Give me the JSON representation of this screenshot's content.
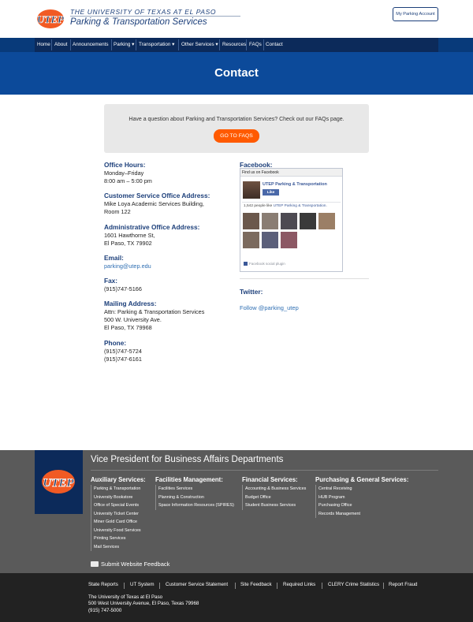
{
  "header": {
    "university": "THE UNIVERSITY OF TEXAS AT EL PASO",
    "department": "Parking & Transportation Services",
    "account_button": "My Parking Account",
    "logo_icon": "utep-logo-icon"
  },
  "nav": {
    "items": [
      "Home",
      "About",
      "Announcements",
      "Parking ▾",
      "Transportation ▾",
      "Other Services ▾",
      "Resources",
      "FAQs",
      "Contact"
    ]
  },
  "hero": {
    "title": "Contact"
  },
  "callout": {
    "text": "Have a question about Parking and Transportation Services? Check out our FAQs page.",
    "button": "GO TO FAQS"
  },
  "contact": {
    "hours_label": "Office Hours:",
    "hours_days": "Monday–Friday",
    "hours_time": "8:00 am – 5:00 pm",
    "customer_label": "Customer Service Office Address:",
    "customer_line1": "Mike Loya Academic Services Building,",
    "customer_line2": "Room 122",
    "admin_label": "Administrative Office Address:",
    "admin_line1": "1601 Hawthorne St,",
    "admin_line2": "El Paso, TX 79902",
    "email_label": "Email:",
    "email": "parking@utep.edu",
    "fax_label": "Fax:",
    "fax": "(915)747-5166",
    "mailing_label": "Mailing Address:",
    "mailing_line1": "Attn: Parking & Transportation Services",
    "mailing_line2": "500 W. University Ave.",
    "mailing_line3": "El Paso, TX 79968",
    "phone_label": "Phone:",
    "phone1": "(915)747-5724",
    "phone2": "(915)747-6161"
  },
  "facebook": {
    "title": "Facebook:",
    "header": "Find us on Facebook",
    "page_name": "UTEP Parking & Transportation",
    "like": "Like",
    "count_prefix": "1,542 people like",
    "count_link": "UTEP Parking & Transportation.",
    "plugin": "Facebook social plugin"
  },
  "twitter": {
    "title": "Twitter:",
    "link": "Follow @parking_utep"
  },
  "footer": {
    "title": "Vice President for Business Affairs Departments",
    "columns": [
      {
        "heading": "Auxiliary Services:",
        "items": [
          "Parking & Transportation",
          "University Bookstore",
          "Office of Special Events",
          "University Ticket Center",
          "Miner Gold Card Office",
          "University Food Services",
          "Printing Services",
          "Mail Services"
        ]
      },
      {
        "heading": "Facilities Management:",
        "items": [
          "Facilities Services",
          "Planning & Construction",
          "Space Information Resources (SPIRES)"
        ]
      },
      {
        "heading": "Financial Services:",
        "items": [
          "Accounting & Business Services",
          "Budget Office",
          "Student Business Services"
        ]
      },
      {
        "heading": "Purchasing & General Services:",
        "items": [
          "Central Receiving",
          "HUB Program",
          "Purchasing Office",
          "Records Management"
        ]
      }
    ],
    "feedback": "Submit Website Feedback",
    "links": [
      "State Reports",
      "UT System",
      "Customer Service Statement",
      "Site Feedback",
      "Required Links",
      "CLERY Crime Statistics",
      "Report Fraud"
    ],
    "address_line1": "The University of Texas at El Paso",
    "address_line2": "500 West University Avenue,  El Paso, Texas 79968",
    "address_line3": "(915) 747-5000"
  },
  "colors": {
    "navy": "#0c2a5a",
    "blue_band": "#0c4a9a",
    "orange": "#ff5a00",
    "link": "#2f6fb3",
    "footer_gray": "#5a5a5a",
    "footer_dark": "#222222"
  }
}
